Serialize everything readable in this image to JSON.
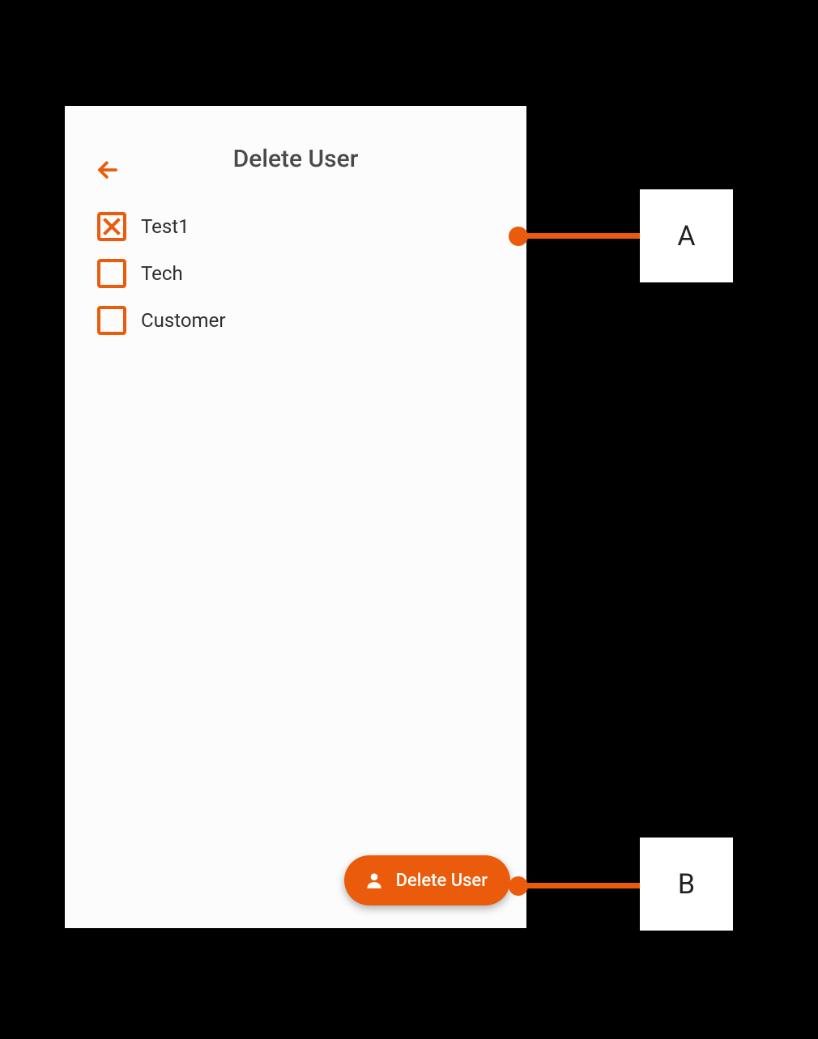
{
  "colors": {
    "accent": "#ea5b0c",
    "text_dark": "#4a4a4a"
  },
  "header": {
    "title": "Delete User"
  },
  "users": [
    {
      "label": "Test1",
      "checked": true
    },
    {
      "label": "Tech",
      "checked": false
    },
    {
      "label": "Customer",
      "checked": false
    }
  ],
  "fab": {
    "label": "Delete User"
  },
  "callouts": {
    "a": "A",
    "b": "B"
  }
}
